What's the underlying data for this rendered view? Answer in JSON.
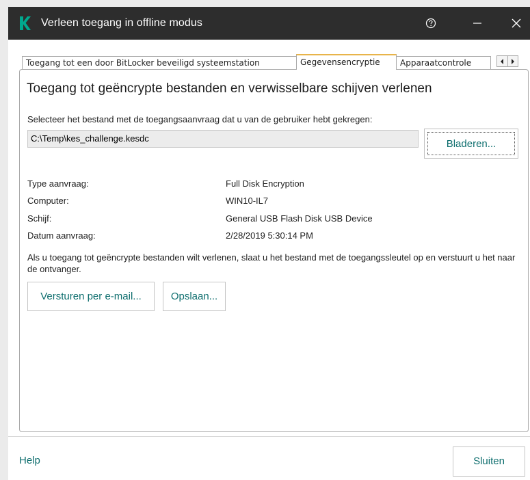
{
  "window": {
    "title": "Verleen toegang in offline modus",
    "accent_color": "#00a88e",
    "titlebar_color": "#2d2d2d",
    "link_color": "#0e6e6e"
  },
  "titlebar_icons": [
    "kaspersky-logo-icon",
    "help-icon",
    "minimize-icon",
    "close-icon"
  ],
  "tabs": [
    {
      "label": "Toegang tot een door BitLocker beveiligd systeemstation",
      "active": false
    },
    {
      "label": "Gegevensencryptie",
      "active": true
    },
    {
      "label": "Apparaatcontrole",
      "active": false
    }
  ],
  "main": {
    "heading": "Toegang tot geëncrypte bestanden en verwisselbare schijven verlenen",
    "select_label": "Selecteer het bestand met de toegangsaanvraag dat u van de gebruiker hebt gekregen:",
    "file_path": "C:\\Temp\\kes_challenge.kesdc",
    "browse_label": "Bladeren...",
    "details": [
      {
        "label": "Type aanvraag:",
        "value": "Full Disk Encryption"
      },
      {
        "label": "Computer:",
        "value": "WIN10-IL7"
      },
      {
        "label": "Schijf:",
        "value": "General USB Flash Disk USB Device"
      },
      {
        "label": "Datum aanvraag:",
        "value": "2/28/2019 5:30:14 PM"
      }
    ],
    "info_text": "Als u toegang tot geëncrypte bestanden wilt verlenen, slaat u het bestand met de toegangssleutel op en verstuurt u het naar de ontvanger.",
    "send_email_label": "Versturen per e-mail...",
    "save_label": "Opslaan..."
  },
  "footer": {
    "help_label": "Help",
    "close_label": "Sluiten"
  }
}
